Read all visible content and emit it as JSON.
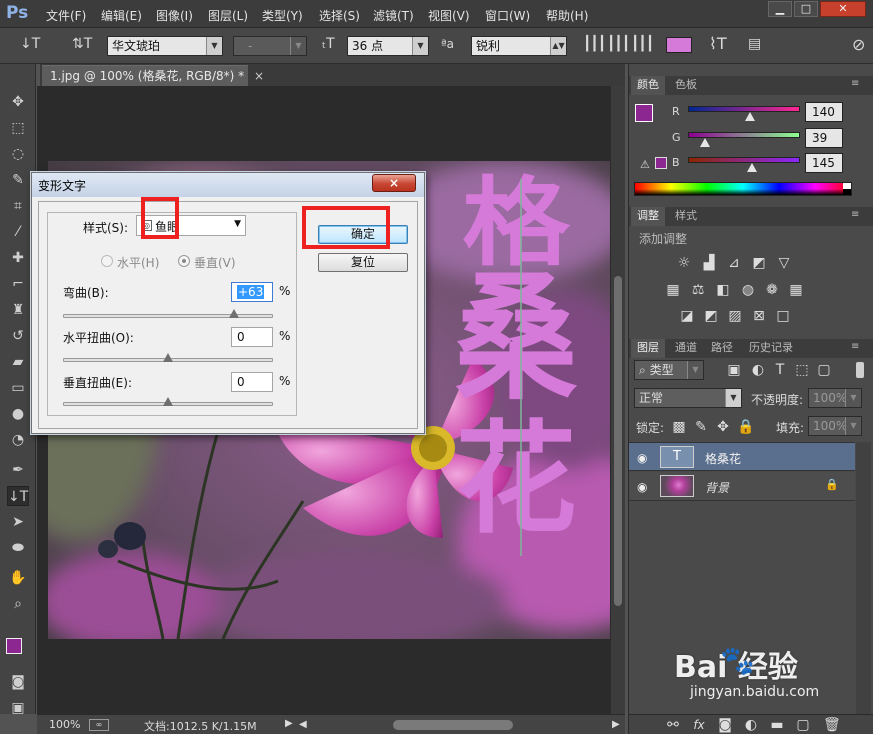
{
  "app": {
    "logo": "Ps"
  },
  "menubar": {
    "items": [
      "文件(F)",
      "编辑(E)",
      "图像(I)",
      "图层(L)",
      "类型(Y)",
      "选择(S)",
      "滤镜(T)",
      "视图(V)",
      "窗口(W)",
      "帮助(H)"
    ]
  },
  "options": {
    "font_family": "华文琥珀",
    "font_style": "-",
    "font_size": "36 点",
    "aa_label": "ªa",
    "antialias": "锐利",
    "text_color": "#d57ad8"
  },
  "document": {
    "tab_title": "1.jpg @ 100% (格桑花, RGB/8*) *",
    "tab_close": "×",
    "warped_text": "格桑花",
    "text_color": "#d57ad8"
  },
  "status": {
    "zoom": "100%",
    "doc_info": "文档:1012.5 K/1.15M"
  },
  "color_panel": {
    "tabs": [
      "颜色",
      "色板"
    ],
    "channels": [
      {
        "label": "R",
        "value": "140"
      },
      {
        "label": "G",
        "value": "39"
      },
      {
        "label": "B",
        "value": "145"
      }
    ],
    "foreground": "#8c2791"
  },
  "adjust_panel": {
    "tabs": [
      "调整",
      "样式"
    ],
    "hint": "添加调整"
  },
  "layers_panel": {
    "tabs": [
      "图层",
      "通道",
      "路径",
      "历史记录"
    ],
    "filter_kind": "类型",
    "blend_mode": "正常",
    "opacity_label": "不透明度:",
    "opacity_value": "100%",
    "lock_label": "锁定:",
    "fill_label": "填充:",
    "fill_value": "100%",
    "layers": [
      {
        "name": "格桑花",
        "type": "text",
        "thumb": "T",
        "selected": true
      },
      {
        "name": "背景",
        "type": "image",
        "selected": false
      }
    ]
  },
  "dialog": {
    "title": "变形文字",
    "close": "×",
    "style_label": "样式(S):",
    "style_value": "鱼眼",
    "horizontal_label": "水平(H)",
    "vertical_label": "垂直(V)",
    "bend_label": "弯曲(B):",
    "bend_value": "+63",
    "bend_pct": 0.815,
    "hdist_label": "水平扭曲(O):",
    "hdist_value": "0",
    "hdist_pct": 0.5,
    "vdist_label": "垂直扭曲(E):",
    "vdist_value": "0",
    "vdist_pct": 0.5,
    "percent": "%",
    "ok_label": "确定",
    "reset_label": "复位"
  },
  "watermark": {
    "brand": "Bai 经验",
    "url": "jingyan.baidu.com"
  }
}
